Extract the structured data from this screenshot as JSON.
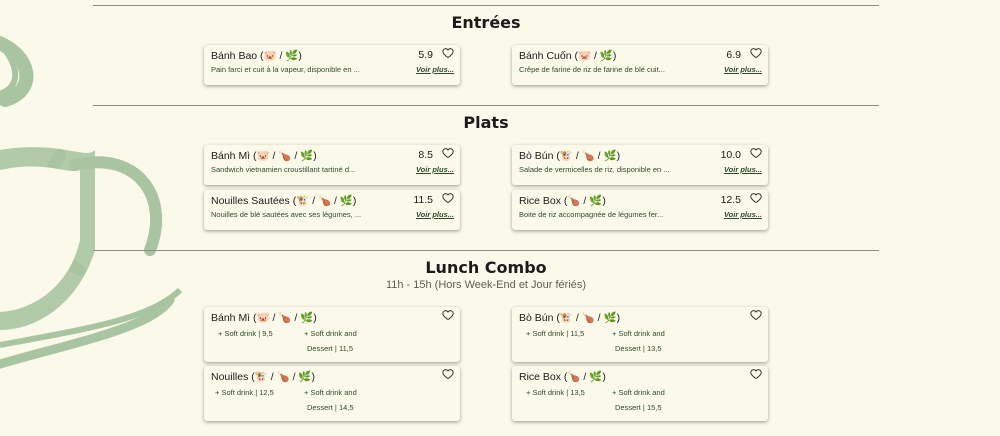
{
  "sections": {
    "entrees": {
      "title": "Entrées",
      "items": [
        {
          "name": "Bánh Bao (🐷 / 🌿)",
          "price": "5.9",
          "desc": "Pain farci et cuit à la vapeur, disponible en ...",
          "more": "Voir plus..."
        },
        {
          "name": "Bánh Cuốn (🐷 / 🌿)",
          "price": "6.9",
          "desc": "Crêpe de farine de riz de farine de blé cuit...",
          "more": "Voir plus..."
        }
      ]
    },
    "plats": {
      "title": "Plats",
      "items": [
        {
          "name": "Bánh Mì (🐷 / 🍗 / 🌿)",
          "price": "8.5",
          "desc": "Sandwich vietnamien croustillant tartiné d...",
          "more": "Voir plus..."
        },
        {
          "name": "Bò Bún (🐮 / 🍗 / 🌿)",
          "price": "10.0",
          "desc": "Salade de vermicelles de riz, disponible en ...",
          "more": "Voir plus..."
        },
        {
          "name": "Nouilles Sautées (🐮 / 🍗 / 🌿)",
          "price": "11.5",
          "desc": "Nouilles de blé sautées avec ses légumes, ...",
          "more": "Voir plus..."
        },
        {
          "name": "Rice Box (🍗 / 🌿)",
          "price": "12.5",
          "desc": "Boite de riz accompagnée de légumes fer...",
          "more": "Voir plus..."
        }
      ]
    },
    "lunch": {
      "title": "Lunch Combo",
      "subtitle": "11h - 15h (Hors Week-End et Jour fériés)",
      "items": [
        {
          "name": "Bánh Mì (🐷 / 🍗 / 🌿)",
          "opt1": "+ Soft drink | 9,5",
          "opt2a": "+ Soft drink and",
          "opt2b": "Dessert | 11,5"
        },
        {
          "name": "Bò Bún (🐮 / 🍗 / 🌿)",
          "opt1": "+ Soft drink | 11,5",
          "opt2a": "+ Soft drink and",
          "opt2b": "Dessert | 13,5"
        },
        {
          "name": "Nouilles (🐮 / 🍗 / 🌿)",
          "opt1": "+ Soft drink | 12,5",
          "opt2a": "+ Soft drink and",
          "opt2b": "Dessert | 14,5"
        },
        {
          "name": "Rice Box (🍗 / 🌿)",
          "opt1": "+ Soft drink | 13,5",
          "opt2a": "+ Soft drink and",
          "opt2b": "Dessert | 15,5"
        }
      ]
    }
  },
  "icons": {
    "favorite": "heart-outline-icon",
    "background": "coffee-cup-illustration"
  },
  "colors": {
    "background": "#fbf9e9",
    "accent_green": "#a8c4a0",
    "text_green": "#2e4a2e",
    "rule": "#8a8f84"
  }
}
